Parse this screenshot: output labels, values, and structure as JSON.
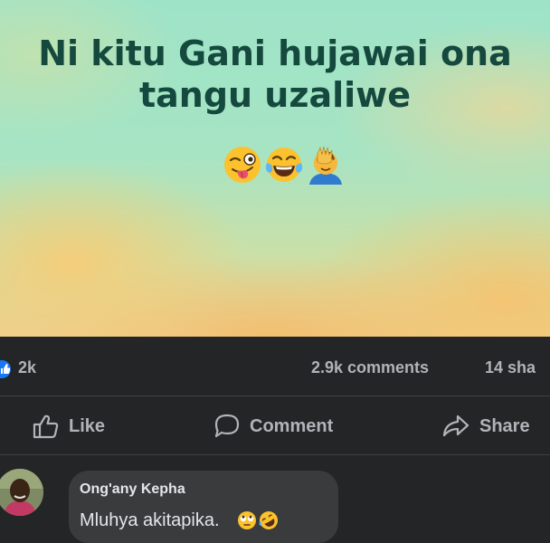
{
  "post": {
    "text_line1": "Ni kitu Gani hujawai ona",
    "text_line2": "tangu uzaliwe",
    "emojis": [
      "winking-tongue-emoji",
      "tears-of-joy-emoji",
      "facepalm-emoji"
    ]
  },
  "stats": {
    "reactions_count": "2k",
    "comments": "2.9k comments",
    "shares": "14 sha"
  },
  "actions": {
    "like": "Like",
    "comment": "Comment",
    "share": "Share"
  },
  "comment": {
    "author": "Ong'any Kepha",
    "text": "Mluhya akitapika.",
    "emojis": [
      "face-with-rolling-eyes-emoji",
      "rolling-on-floor-laughing-emoji"
    ]
  },
  "colors": {
    "background": "#242526",
    "secondary_text": "#b0b3b8",
    "primary_text": "#e4e6eb",
    "bubble": "#3a3b3c",
    "like_blue": "#1877f2",
    "post_text": "#15493e"
  }
}
